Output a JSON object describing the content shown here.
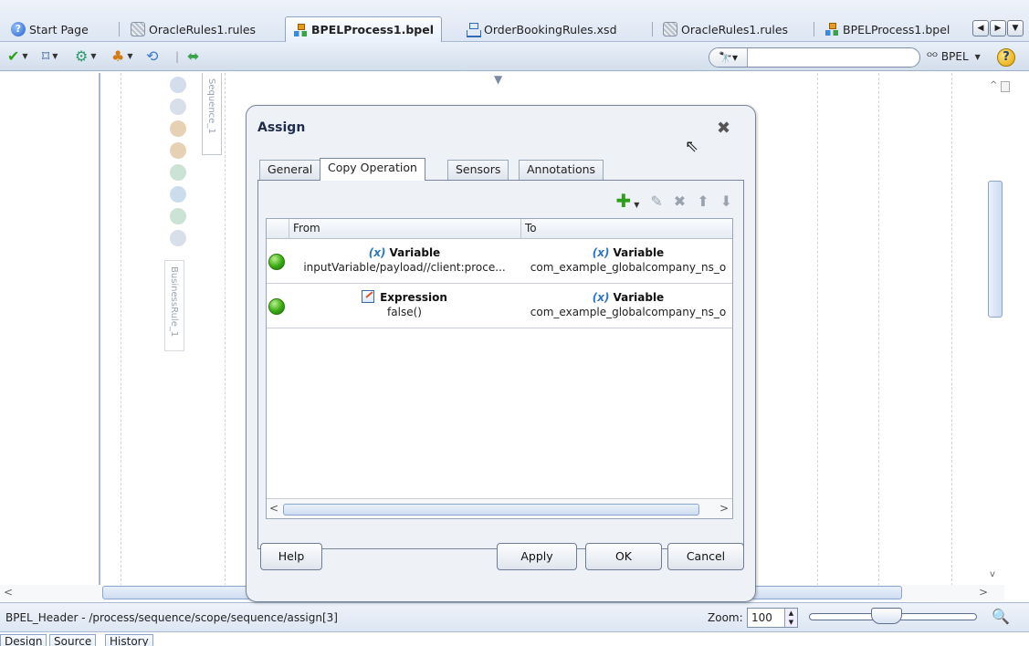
{
  "tabs": [
    {
      "label": "Start Page",
      "icon": "help-icon",
      "active": false
    },
    {
      "label": "OracleRules1.rules",
      "icon": "rules-icon",
      "active": false
    },
    {
      "label": "BPELProcess1.bpel",
      "icon": "bpel-icon",
      "active": true
    },
    {
      "label": "OrderBookingRules.xsd",
      "icon": "xsd-icon",
      "active": false
    },
    {
      "label": "OracleRules1.rules",
      "icon": "rules-icon",
      "active": false
    },
    {
      "label": "BPELProcess1.bpel",
      "icon": "bpel-icon",
      "active": false
    }
  ],
  "toolbar": {
    "search_placeholder": "",
    "mode_label": "BPEL"
  },
  "canvas": {
    "sequence_label": "Sequence_1",
    "businessrule_label": "BusinessRule_1"
  },
  "dialog": {
    "title": "Assign",
    "tabs": [
      "General",
      "Copy Operation",
      "Sensors",
      "Annotations"
    ],
    "active_tab": "Copy Operation",
    "columns": {
      "from": "From",
      "to": "To"
    },
    "rows": [
      {
        "from_kind": "Variable",
        "from_value": "inputVariable/payload//client:proce...",
        "to_kind": "Variable",
        "to_value": "com_example_globalcompany_ns_o"
      },
      {
        "from_kind": "Expression",
        "from_value": "false()",
        "to_kind": "Variable",
        "to_value": "com_example_globalcompany_ns_o"
      }
    ],
    "variable_prefix": "(x)",
    "buttons": {
      "help": "Help",
      "apply": "Apply",
      "ok": "OK",
      "cancel": "Cancel"
    }
  },
  "status": {
    "path": "BPEL_Header - /process/sequence/scope/sequence/assign[3]",
    "zoom_label": "Zoom:",
    "zoom_value": "100"
  },
  "bottom_tabs": [
    "Design",
    "Source",
    "History"
  ],
  "colors": {
    "accent": "#2a76c6",
    "status_ok": "#3aa913",
    "chrome": "#dde6f3"
  }
}
